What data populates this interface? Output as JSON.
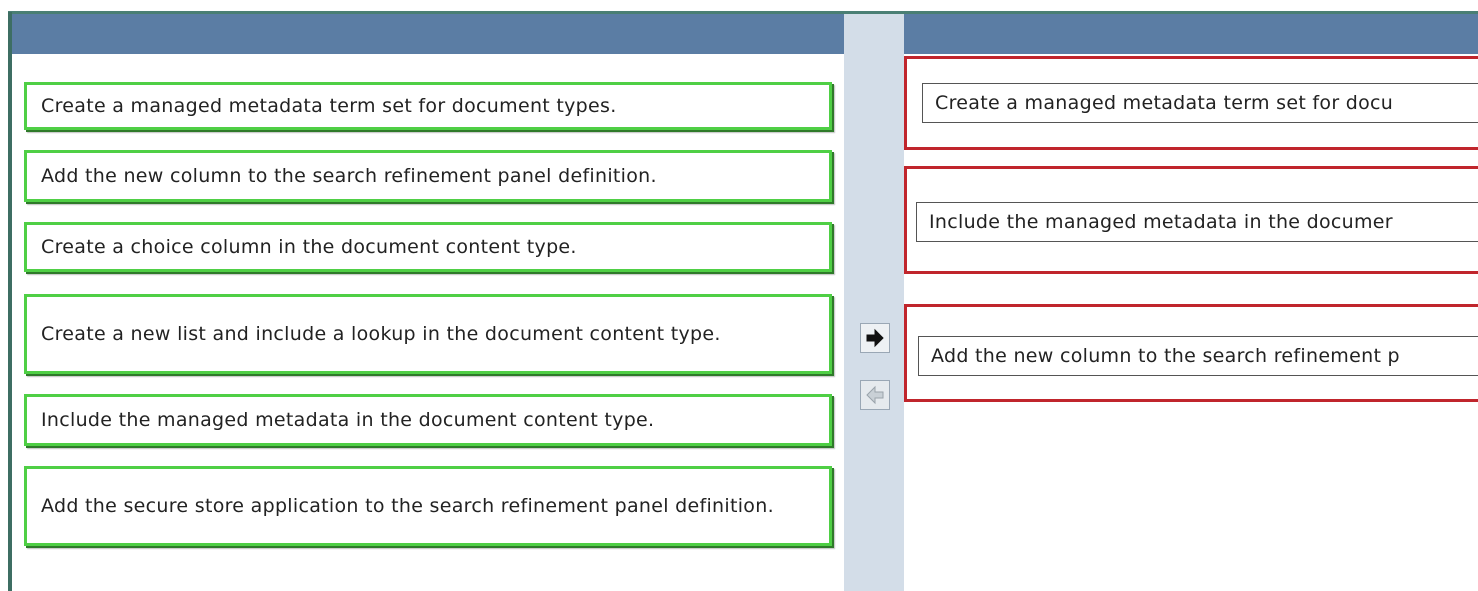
{
  "source_items": [
    {
      "label": "Create a managed metadata term set for document types."
    },
    {
      "label": "Add the new column to the search refinement panel definition."
    },
    {
      "label": "Create a choice column in the document content type."
    },
    {
      "label": "Create a new list and include a lookup in the document content type."
    },
    {
      "label": "Include the managed metadata in the document content type."
    },
    {
      "label": "Add the secure store application to the search refinement panel definition."
    }
  ],
  "answer_items": [
    {
      "label": "Create a managed metadata term set for docu"
    },
    {
      "label": "Include the managed metadata in the documer"
    },
    {
      "label": "Add the new column to the search refinement p"
    }
  ],
  "buttons": {
    "move_right_icon": "arrow-right-icon",
    "move_left_icon": "arrow-left-icon"
  },
  "colors": {
    "header": "#5b7da4",
    "source_border": "#4fcf45",
    "target_border": "#c0252c"
  }
}
